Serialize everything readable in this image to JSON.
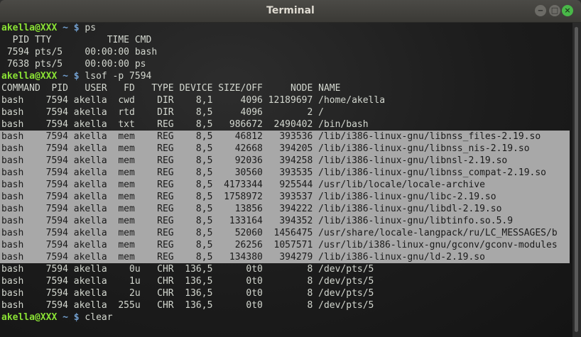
{
  "window": {
    "title": "Terminal",
    "buttons": {
      "minimize": "‒",
      "maximize": "□",
      "close": "×"
    }
  },
  "terminal": {
    "lines": [
      {
        "type": "prompt",
        "user": "akella@XXX",
        "path": "~",
        "sym": "$",
        "cmd": "ps"
      },
      {
        "type": "text",
        "text": "  PID TTY          TIME CMD"
      },
      {
        "type": "text",
        "text": " 7594 pts/5    00:00:00 bash"
      },
      {
        "type": "text",
        "text": " 7638 pts/5    00:00:00 ps"
      },
      {
        "type": "prompt",
        "user": "akella@XXX",
        "path": "~",
        "sym": "$",
        "cmd": "lsof -p 7594"
      },
      {
        "type": "text",
        "text": "COMMAND  PID   USER   FD   TYPE DEVICE SIZE/OFF     NODE NAME"
      },
      {
        "type": "text",
        "text": "bash    7594 akella  cwd    DIR    8,1     4096 12189697 /home/akella"
      },
      {
        "type": "text",
        "text": "bash    7594 akella  rtd    DIR    8,5     4096        2 /"
      },
      {
        "type": "text",
        "text": "bash    7594 akella  txt    REG    8,5   986672  2490402 /bin/bash"
      },
      {
        "type": "hl",
        "text": "bash    7594 akella  mem    REG    8,5    46812   393536 /lib/i386-linux-gnu/libnss_files-2.19.so"
      },
      {
        "type": "hl",
        "text": "bash    7594 akella  mem    REG    8,5    42668   394205 /lib/i386-linux-gnu/libnss_nis-2.19.so"
      },
      {
        "type": "hl",
        "text": "bash    7594 akella  mem    REG    8,5    92036   394258 /lib/i386-linux-gnu/libnsl-2.19.so"
      },
      {
        "type": "hl",
        "text": "bash    7594 akella  mem    REG    8,5    30560   393535 /lib/i386-linux-gnu/libnss_compat-2.19.so"
      },
      {
        "type": "hl",
        "text": "bash    7594 akella  mem    REG    8,5  4173344   925544 /usr/lib/locale/locale-archive"
      },
      {
        "type": "hl",
        "text": "bash    7594 akella  mem    REG    8,5  1758972   393537 /lib/i386-linux-gnu/libc-2.19.so"
      },
      {
        "type": "hl",
        "text": "bash    7594 akella  mem    REG    8,5    13856   394222 /lib/i386-linux-gnu/libdl-2.19.so"
      },
      {
        "type": "hl",
        "text": "bash    7594 akella  mem    REG    8,5   133164   394352 /lib/i386-linux-gnu/libtinfo.so.5.9"
      },
      {
        "type": "hl",
        "text": "bash    7594 akella  mem    REG    8,5    52060  1456475 /usr/share/locale-langpack/ru/LC_MESSAGES/b"
      },
      {
        "type": "hl",
        "text": "bash    7594 akella  mem    REG    8,5    26256  1057571 /usr/lib/i386-linux-gnu/gconv/gconv-modules"
      },
      {
        "type": "hl",
        "text": "bash    7594 akella  mem    REG    8,5   134380   394279 /lib/i386-linux-gnu/ld-2.19.so"
      },
      {
        "type": "text",
        "text": "bash    7594 akella    0u   CHR  136,5      0t0        8 /dev/pts/5"
      },
      {
        "type": "text",
        "text": "bash    7594 akella    1u   CHR  136,5      0t0        8 /dev/pts/5"
      },
      {
        "type": "text",
        "text": "bash    7594 akella    2u   CHR  136,5      0t0        8 /dev/pts/5"
      },
      {
        "type": "text",
        "text": "bash    7594 akella  255u   CHR  136,5      0t0        8 /dev/pts/5"
      },
      {
        "type": "prompt",
        "user": "akella@XXX",
        "path": "~",
        "sym": "$",
        "cmd": "clear"
      }
    ]
  },
  "colors": {
    "prompt_user": "#8ae234",
    "prompt_path": "#729fcf",
    "highlight_bg": "#a8a8a8",
    "close_button": "#49b848"
  }
}
